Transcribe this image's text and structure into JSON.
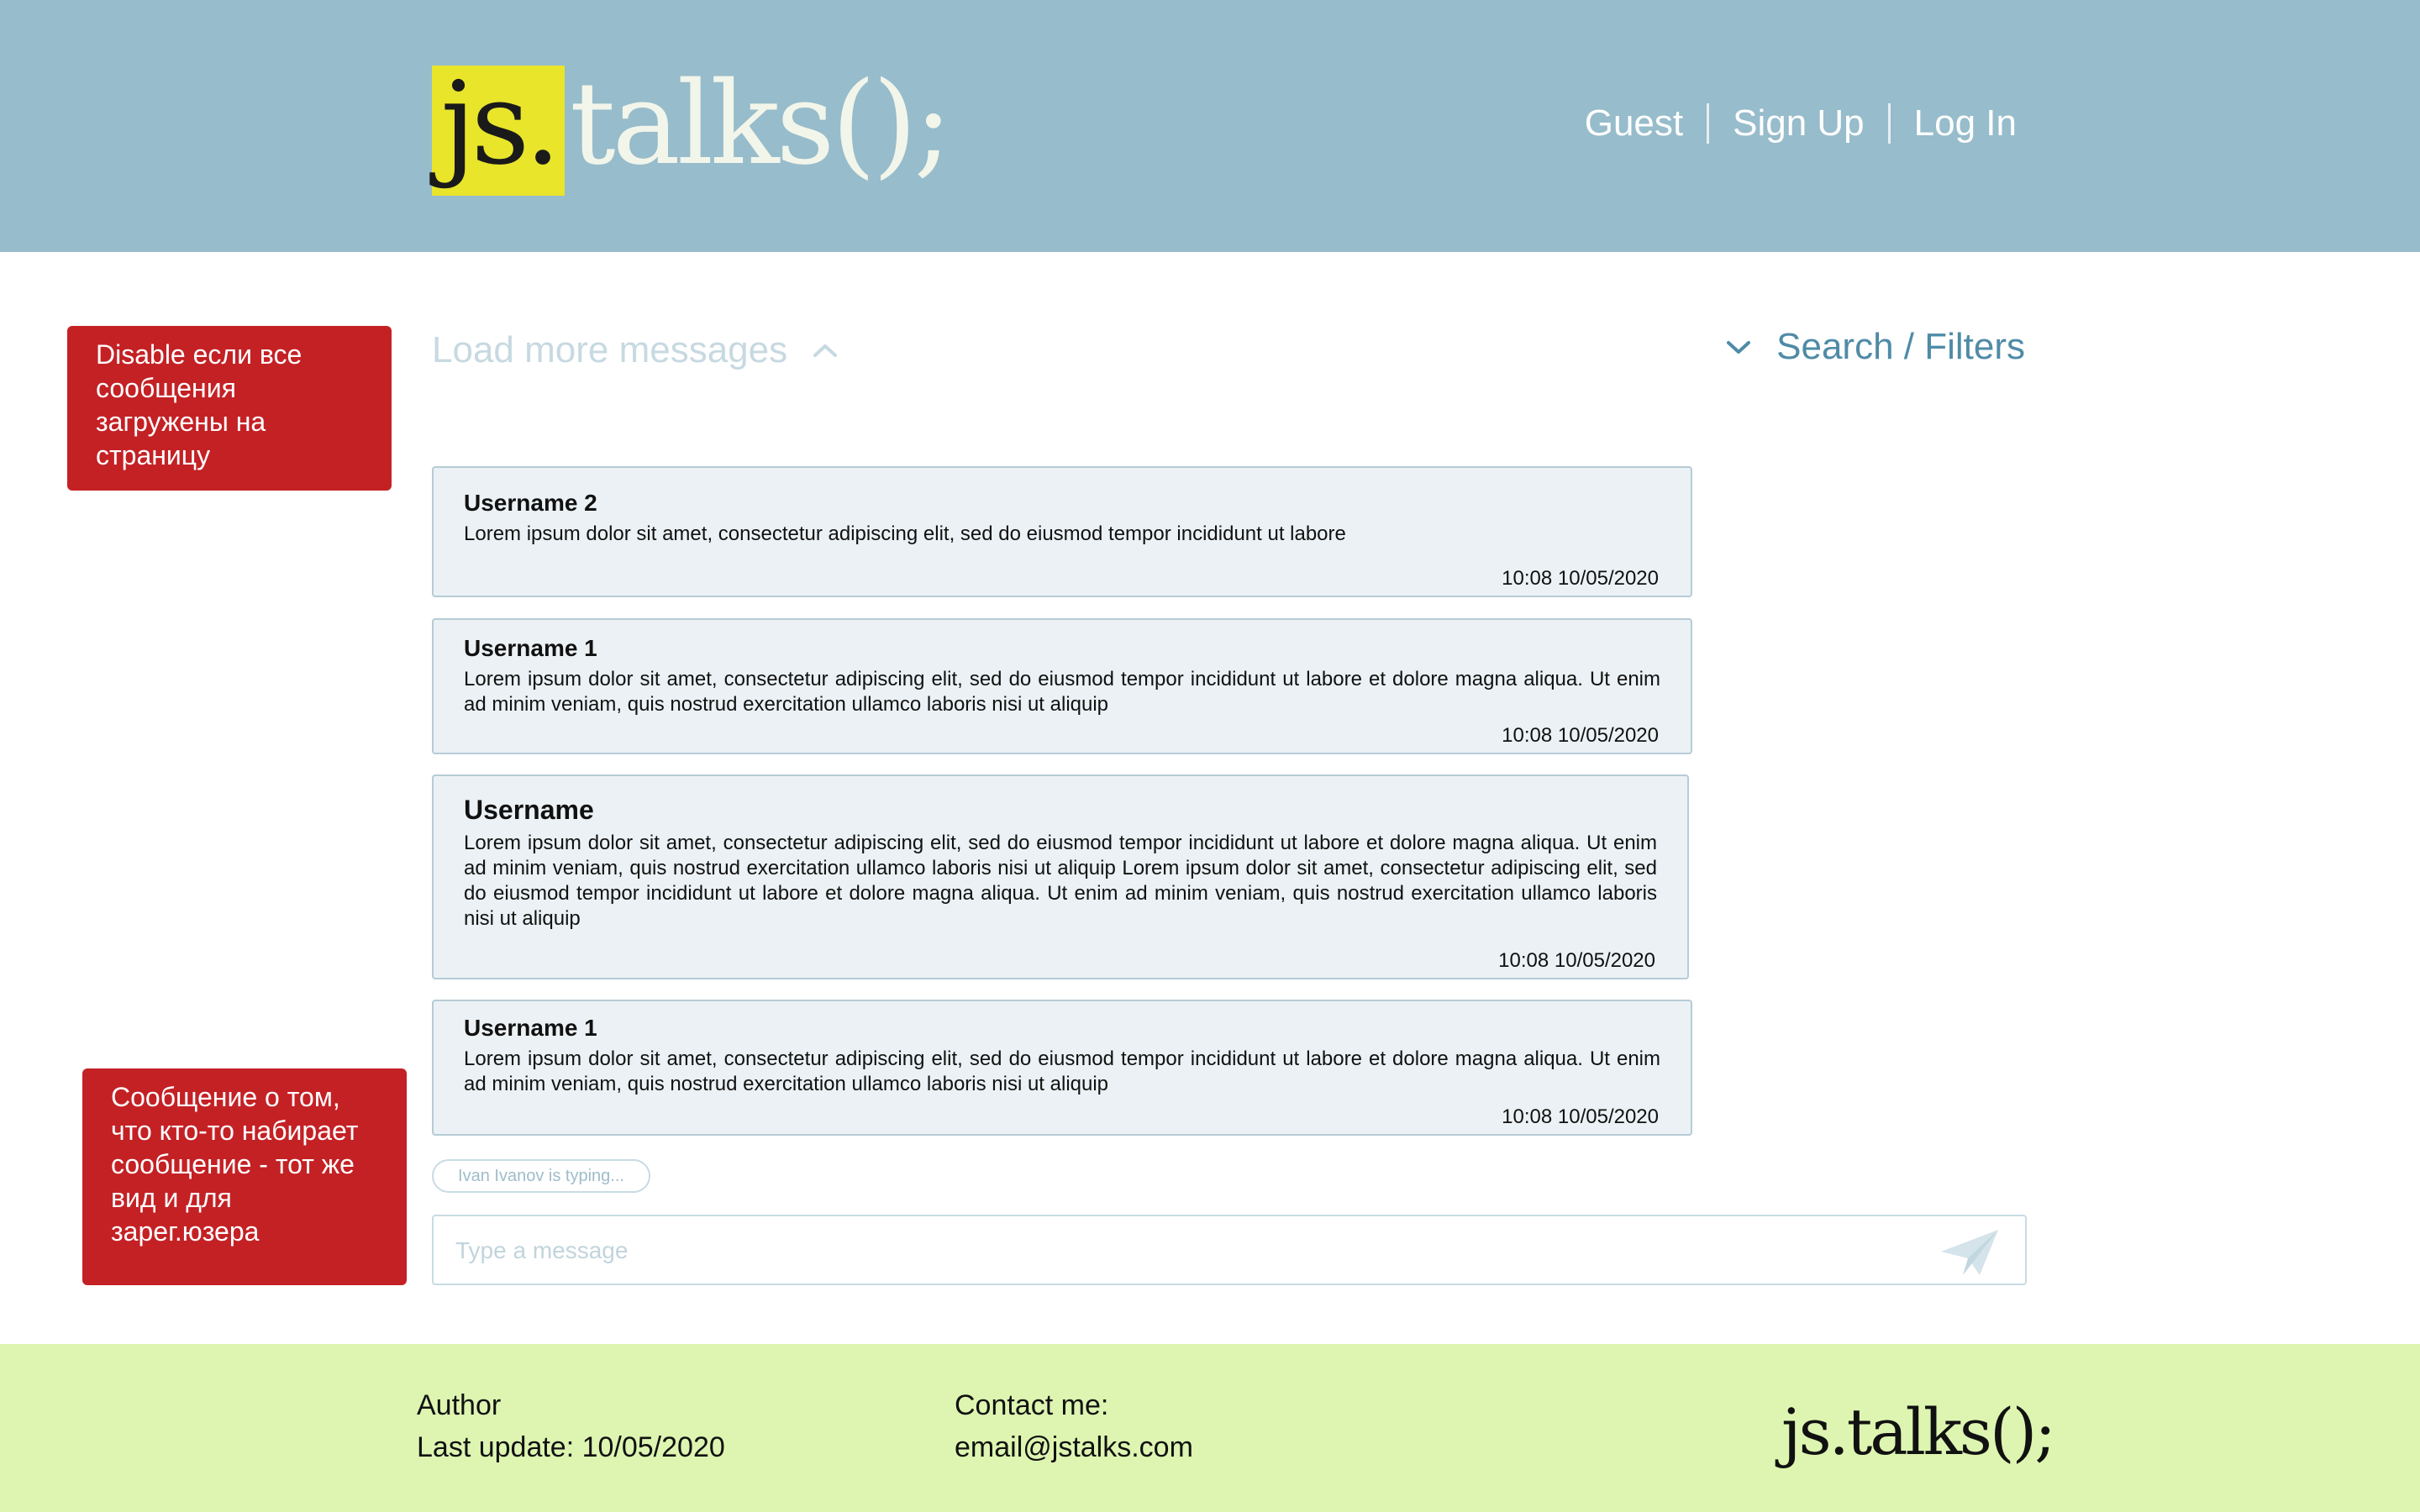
{
  "header": {
    "logo_js": "js.",
    "logo_rest": "talks();",
    "nav": {
      "guest": "Guest",
      "sign_up": "Sign Up",
      "log_in": "Log In"
    }
  },
  "annotations": {
    "load_more_note": "Disable если все сообщения загружены на страницу",
    "typing_note": "Сообщение о том, что кто-то набирает сообщение - тот же вид и для зарег.юзера"
  },
  "chat": {
    "load_more": "Load more messages",
    "search_filters": "Search / Filters",
    "messages": [
      {
        "user": "Username 2",
        "text": "Lorem ipsum dolor sit amet, consectetur adipiscing elit, sed do eiusmod tempor incididunt ut labore",
        "time": "10:08 10/05/2020"
      },
      {
        "user": "Username 1",
        "text": "Lorem ipsum dolor sit amet, consectetur adipiscing elit, sed do eiusmod tempor incididunt ut labore et dolore magna aliqua. Ut enim ad minim veniam, quis nostrud exercitation ullamco laboris nisi ut aliquip",
        "time": "10:08 10/05/2020"
      },
      {
        "user": "Username",
        "text": "Lorem ipsum dolor sit amet, consectetur adipiscing elit, sed do eiusmod tempor incididunt ut labore et dolore magna aliqua. Ut enim ad minim veniam, quis nostrud exercitation ullamco laboris nisi ut aliquip Lorem ipsum dolor sit amet, consectetur adipiscing elit, sed do eiusmod tempor incididunt ut labore et dolore magna aliqua. Ut enim ad minim veniam, quis nostrud exercitation ullamco laboris nisi ut aliquip",
        "time": "10:08 10/05/2020"
      },
      {
        "user": "Username 1",
        "text": "Lorem ipsum dolor sit amet, consectetur adipiscing elit, sed do eiusmod tempor incididunt ut labore et dolore magna aliqua. Ut enim ad minim veniam, quis nostrud exercitation ullamco laboris nisi ut aliquip",
        "time": "10:08 10/05/2020"
      }
    ],
    "typing": "Ivan Ivanov is typing...",
    "input_placeholder": "Type a message"
  },
  "footer": {
    "author": "Author",
    "last_update": "Last update: 10/05/2020",
    "contact_label": "Contact me:",
    "email": "email@jstalks.com",
    "logo": "js.talks();"
  },
  "colors": {
    "header_bg": "#97bccb",
    "logo_accent": "#e8e52b",
    "note_bg": "#c42125",
    "footer_bg": "#ddf5b1",
    "link": "#4f8ba7"
  },
  "icons": [
    "chevron-up-icon",
    "chevron-down-icon",
    "send-icon"
  ]
}
